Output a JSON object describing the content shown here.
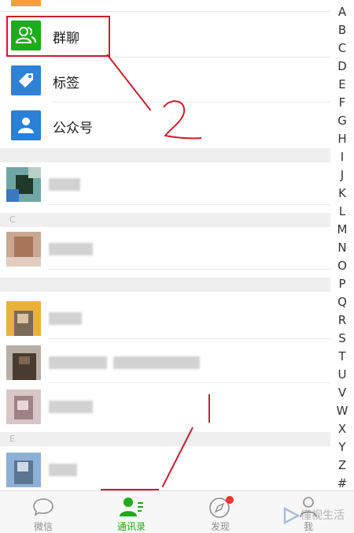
{
  "functions": {
    "group_chat": "群聊",
    "tags": "标签",
    "official_accounts": "公众号"
  },
  "sections": [
    "",
    "C",
    "",
    "E"
  ],
  "index_letters": [
    "A",
    "B",
    "C",
    "D",
    "E",
    "F",
    "G",
    "H",
    "I",
    "J",
    "K",
    "L",
    "M",
    "N",
    "O",
    "P",
    "Q",
    "R",
    "S",
    "T",
    "U",
    "V",
    "W",
    "X",
    "Y",
    "Z",
    "#"
  ],
  "tabs": {
    "chats": "微信",
    "contacts": "通讯录",
    "discover": "发现",
    "me": "我"
  },
  "annotations": {
    "step2_mark": "2",
    "step1_mark": "1"
  },
  "watermark": "懂视生活",
  "colors": {
    "group_icon": "#1aad19",
    "tags_icon": "#2f82d6",
    "official_icon": "#2a7fd6",
    "active_tab": "#1aad19",
    "annotation": "#c8202c",
    "badge": "#f43530"
  }
}
